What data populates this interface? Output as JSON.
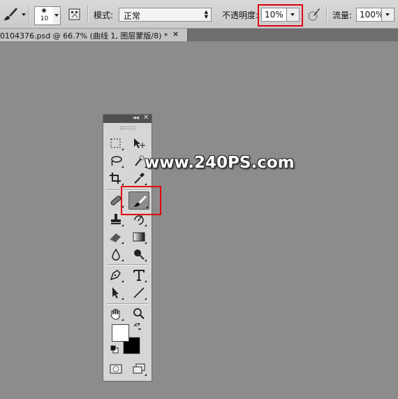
{
  "options_bar": {
    "brush_size": "10",
    "mode_label": "模式:",
    "mode_value": "正常",
    "opacity_label": "不透明度:",
    "opacity_value": "10%",
    "flow_label": "流量:",
    "flow_value": "100%"
  },
  "document_tab": {
    "title": "0104376.psd @ 66.7% (曲线 1, 图层蒙版/8) *",
    "close": "×"
  },
  "canvas": {
    "watermark": "www.240PS.com"
  },
  "tools_panel": {
    "collapse": "◂◂",
    "close": "✕",
    "active_tool": "brush-tool",
    "foreground_color": "#ffffff",
    "background_color": "#000000"
  },
  "highlight_color": "#e0000f"
}
